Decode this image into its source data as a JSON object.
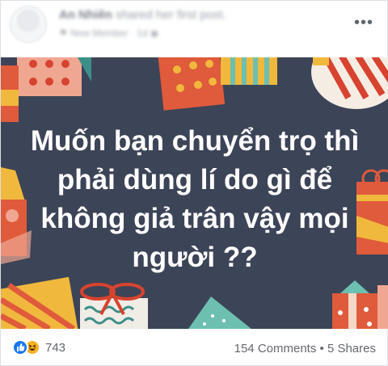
{
  "post": {
    "author": "An Nhiên",
    "action": "shared her first post.",
    "badge": "New Member",
    "time": "1d",
    "menu_icon": "more-horizontal-icon",
    "image_text": [
      "Muốn bạn chuyển trọ thì",
      "phải dùng lí do gì để",
      "không giả trân vậy mọi",
      "người ??"
    ]
  },
  "footer": {
    "reaction_icons": [
      "like-icon",
      "haha-icon"
    ],
    "reaction_count": "743",
    "comments": "154 Comments",
    "separator": "•",
    "shares": "5 Shares"
  },
  "colors": {
    "image_bg": "#3c4457",
    "like": "#1877f2",
    "haha": "#f7b125",
    "meta_text": "#65676b"
  }
}
